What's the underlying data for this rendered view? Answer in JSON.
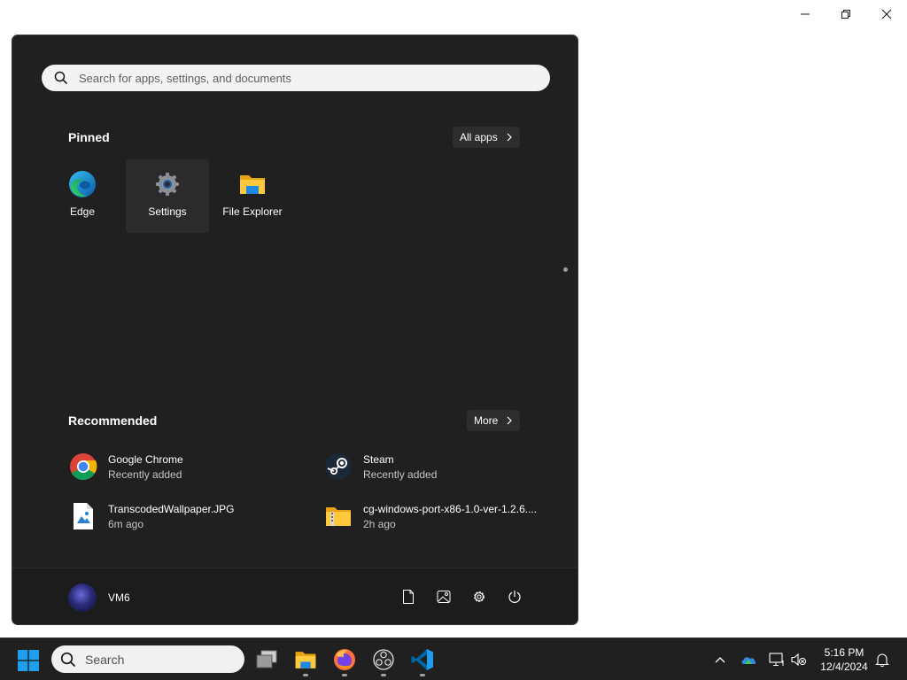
{
  "window_controls": {
    "minimize_icon": "minimize-icon",
    "restore_icon": "restore-icon",
    "close_icon": "close-icon"
  },
  "start_menu": {
    "search": {
      "placeholder": "Search for apps, settings, and documents",
      "icon": "search-icon"
    },
    "pinned": {
      "title": "Pinned",
      "all_apps_label": "All apps",
      "items": [
        {
          "label": "Edge",
          "icon": "edge-icon"
        },
        {
          "label": "Settings",
          "icon": "settings-gear-icon"
        },
        {
          "label": "File Explorer",
          "icon": "folder-icon"
        }
      ]
    },
    "recommended": {
      "title": "Recommended",
      "more_label": "More",
      "items": [
        {
          "name": "Google Chrome",
          "sub": "Recently added",
          "icon": "chrome-icon"
        },
        {
          "name": "Steam",
          "sub": "Recently added",
          "icon": "steam-icon"
        },
        {
          "name": "TranscodedWallpaper.JPG",
          "sub": "6m ago",
          "icon": "image-file-icon"
        },
        {
          "name": "cg-windows-port-x86-1.0-ver-1.2.6....",
          "sub": "2h ago",
          "icon": "zip-folder-icon"
        }
      ]
    },
    "footer": {
      "user_name": "VM6",
      "icons": [
        "document-icon",
        "pictures-icon",
        "settings-icon",
        "power-icon"
      ]
    }
  },
  "taskbar": {
    "search_placeholder": "Search",
    "apps": [
      "task-view-icon",
      "file-explorer-icon",
      "firefox-icon",
      "obs-icon",
      "vscode-icon"
    ],
    "tray": [
      "chevron-up-icon",
      "onedrive-icon",
      "network-icon",
      "volume-muted-icon",
      "notification-bell-icon"
    ],
    "time": "5:16 PM",
    "date": "12/4/2024"
  },
  "colors": {
    "menu_bg": "#202020",
    "taskbar_bg": "#202020",
    "accent_blue": "#0078d4",
    "folder_yellow": "#ffc83d"
  }
}
